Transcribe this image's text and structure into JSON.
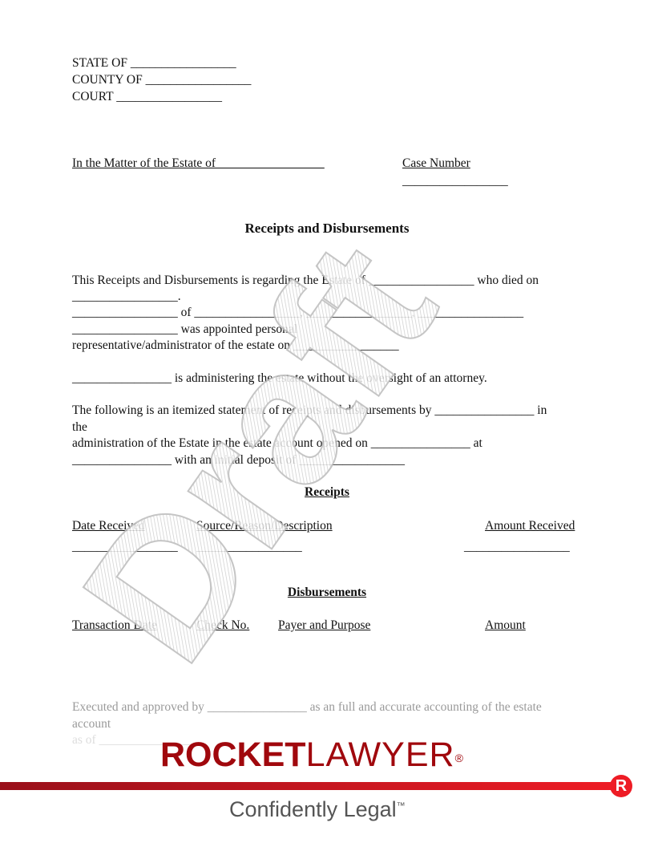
{
  "header": {
    "state": "STATE OF _________________",
    "county": "COUNTY OF _________________",
    "court": "COURT _________________"
  },
  "matter": {
    "estate_of": "In the Matter of the Estate of _________________",
    "case_number": "Case Number",
    "case_blank": "_________________"
  },
  "title": "Receipts and Disbursements",
  "body": {
    "l1": "This Receipts and Disbursements is regarding the Estate of _________________ who died on",
    "l2": "_________________.",
    "l3": "_________________ of _________________, _________________, _________________",
    "l4": "_________________ was appointed personal",
    "l5": "representative/administrator of the estate on _________________",
    "l6": "________________ is administering the estate without the oversight of an attorney.",
    "l7": "The following is an itemized statement of receipts and disbursements by ________________ in",
    "l8": "the",
    "l9": "administration of the Estate in the estate account opened on ________________ at",
    "l10": "________________ with an initial deposit of _________________"
  },
  "receipts": {
    "heading": "Receipts",
    "columns": [
      "Date Received",
      "Source/Reason/Description",
      "Amount Received"
    ],
    "blanks": [
      "_________________",
      "_________________",
      "_________________"
    ]
  },
  "disbursements": {
    "heading": "Disbursements",
    "columns": [
      "Transaction Date",
      "Check No.",
      "Payer and Purpose",
      "Amount"
    ]
  },
  "closing": {
    "l1": "Executed and approved by ________________ as an full and accurate accounting of the estate",
    "l2": "account",
    "l3": "as of ________________"
  },
  "watermark": "Draft",
  "footer": {
    "logo": "ROCKETLAWYER",
    "logo_bold": "ROCKET",
    "logo_light": "LAWYER",
    "registered": "®",
    "badge": "R",
    "tagline": "Confidently Legal",
    "tm": "™",
    "brand_color": "#a0080d",
    "accent_color": "#ee1c25"
  }
}
